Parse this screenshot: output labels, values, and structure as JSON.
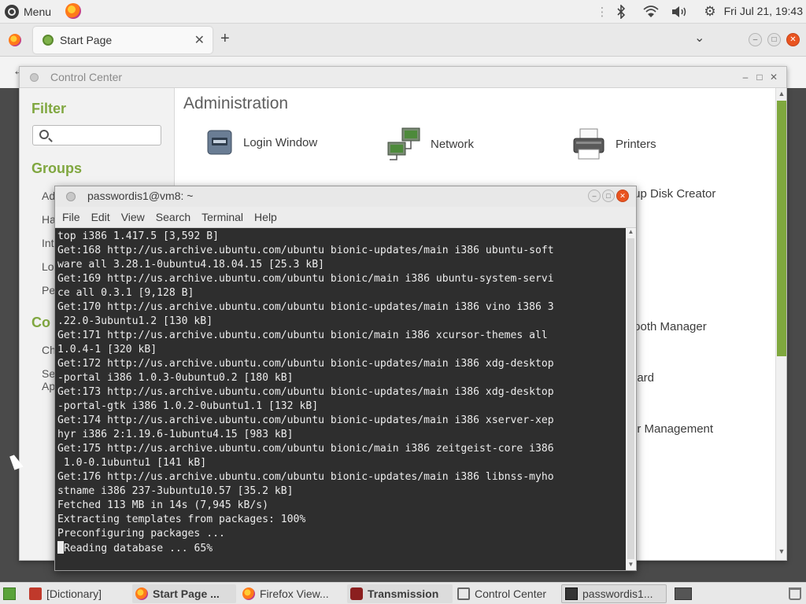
{
  "top_panel": {
    "menu_label": "Menu",
    "clock": "Fri Jul 21, 19:43"
  },
  "firefox": {
    "tab_title": "Start Page"
  },
  "control_center": {
    "title": "Control Center",
    "sidebar": {
      "filter_heading": "Filter",
      "search_placeholder": "",
      "groups_heading": "Groups",
      "group_items": [
        "Ad",
        "Ha",
        "Int",
        "Lo",
        "Pe"
      ],
      "second_heading": "Co",
      "second_items": [
        "Ch",
        "Se",
        "Ap"
      ]
    },
    "section_heading": "Administration",
    "items": {
      "login_window": "Login Window",
      "network": "Network",
      "printers": "Printers",
      "startup_disk": "tup Disk Creator",
      "bluetooth": "tooth Manager",
      "keyboard": "oard",
      "user_mgmt": "er Management"
    }
  },
  "terminal": {
    "title": "passwordis1@vm8: ~",
    "menu": [
      "File",
      "Edit",
      "View",
      "Search",
      "Terminal",
      "Help"
    ],
    "lines": [
      "top i386 1.417.5 [3,592 B]",
      "Get:168 http://us.archive.ubuntu.com/ubuntu bionic-updates/main i386 ubuntu-soft",
      "ware all 3.28.1-0ubuntu4.18.04.15 [25.3 kB]",
      "Get:169 http://us.archive.ubuntu.com/ubuntu bionic/main i386 ubuntu-system-servi",
      "ce all 0.3.1 [9,128 B]",
      "Get:170 http://us.archive.ubuntu.com/ubuntu bionic-updates/main i386 vino i386 3",
      ".22.0-3ubuntu1.2 [130 kB]",
      "Get:171 http://us.archive.ubuntu.com/ubuntu bionic/main i386 xcursor-themes all",
      "1.0.4-1 [320 kB]",
      "Get:172 http://us.archive.ubuntu.com/ubuntu bionic-updates/main i386 xdg-desktop",
      "-portal i386 1.0.3-0ubuntu0.2 [180 kB]",
      "Get:173 http://us.archive.ubuntu.com/ubuntu bionic-updates/main i386 xdg-desktop",
      "-portal-gtk i386 1.0.2-0ubuntu1.1 [132 kB]",
      "Get:174 http://us.archive.ubuntu.com/ubuntu bionic-updates/main i386 xserver-xep",
      "hyr i386 2:1.19.6-1ubuntu4.15 [983 kB]",
      "Get:175 http://us.archive.ubuntu.com/ubuntu bionic/main i386 zeitgeist-core i386",
      " 1.0-0.1ubuntu1 [141 kB]",
      "Get:176 http://us.archive.ubuntu.com/ubuntu bionic-updates/main i386 libnss-myho",
      "stname i386 237-3ubuntu10.57 [35.2 kB]",
      "Fetched 113 MB in 14s (7,945 kB/s)",
      "Extracting templates from packages: 100%",
      "Preconfiguring packages ...",
      "Reading database ... 65%"
    ],
    "last_prefix": "("
  },
  "taskbar": {
    "items": [
      "[Dictionary]",
      "Start Page ...",
      "Firefox View...",
      "Transmission",
      "Control Center",
      "passwordis1..."
    ]
  },
  "colors": {
    "accent_green": "#80a740",
    "close_orange": "#e95420",
    "terminal_bg": "#2e2e2e"
  }
}
